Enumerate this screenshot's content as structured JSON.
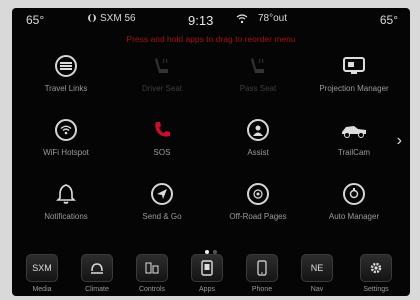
{
  "status_bar": {
    "temp_left": "65°",
    "radio_source": "SXM 56",
    "time": "9:13",
    "outside_temp": "78°out",
    "temp_right": "65°"
  },
  "notice": "Press and hold apps to drag to reorder menu",
  "apps": [
    {
      "label": "Travel Links",
      "icon": "travel-links-icon",
      "enabled": true
    },
    {
      "label": "Driver Seat",
      "icon": "driver-seat-icon",
      "enabled": false
    },
    {
      "label": "Pass Seat",
      "icon": "passenger-seat-icon",
      "enabled": false
    },
    {
      "label": "Projection Manager",
      "icon": "projection-manager-icon",
      "enabled": true
    },
    {
      "label": "WiFi Hotspot",
      "icon": "wifi-hotspot-icon",
      "enabled": true
    },
    {
      "label": "SOS",
      "icon": "phone-icon",
      "enabled": true
    },
    {
      "label": "Assist",
      "icon": "assist-icon",
      "enabled": true
    },
    {
      "label": "TrailCam",
      "icon": "trailcam-icon",
      "enabled": true
    },
    {
      "label": "Notifications",
      "icon": "bell-icon",
      "enabled": true
    },
    {
      "label": "Send & Go",
      "icon": "send-and-go-icon",
      "enabled": true
    },
    {
      "label": "Off-Road Pages",
      "icon": "off-road-pages-icon",
      "enabled": true
    },
    {
      "label": "Auto Manager",
      "icon": "auto-manager-icon",
      "enabled": true
    }
  ],
  "page_dots": {
    "count": 2,
    "active": 1
  },
  "dock": [
    {
      "label": "Media",
      "icon": "media-icon",
      "glyph": "SXM"
    },
    {
      "label": "Climate",
      "icon": "climate-icon",
      "glyph": ""
    },
    {
      "label": "Controls",
      "icon": "controls-icon",
      "glyph": ""
    },
    {
      "label": "Apps",
      "icon": "apps-icon",
      "glyph": ""
    },
    {
      "label": "Phone",
      "icon": "phone-icon",
      "glyph": ""
    },
    {
      "label": "Nav",
      "icon": "nav-icon",
      "glyph": "NE"
    },
    {
      "label": "Settings",
      "icon": "settings-icon",
      "glyph": ""
    }
  ],
  "colors": {
    "notice": "#a11414",
    "sos": "#c8102e",
    "background": "#050505"
  }
}
